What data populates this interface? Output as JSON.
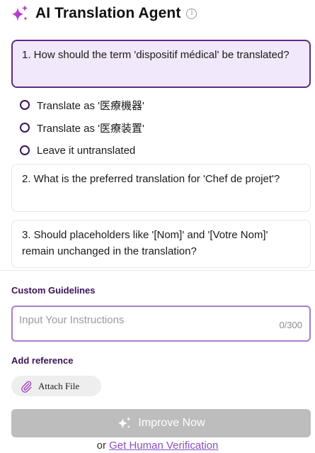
{
  "header": {
    "title": "AI Translation Agent",
    "info_glyph": "i",
    "sparkle_icon": "sparkles-icon",
    "brand_gradient": [
      "#e03cbd",
      "#8b3ad9"
    ]
  },
  "questions": [
    {
      "text": "1. How should the term 'dispositif médical' be translated?",
      "active": true
    },
    {
      "text": "2. What is the preferred translation for 'Chef de projet'?",
      "active": false
    },
    {
      "text": "3. Should placeholders like '[Nom]' and '[Votre Nom]' remain unchanged in the translation?",
      "active": false
    }
  ],
  "options": [
    {
      "label": "Translate as '医療機器'",
      "selected": false
    },
    {
      "label": "Translate as '医療装置'",
      "selected": false
    },
    {
      "label": "Leave it untranslated",
      "selected": false
    }
  ],
  "guidelines": {
    "label": "Custom Guidelines",
    "placeholder": "Input Your Instructions",
    "value": "",
    "counter": "0/300"
  },
  "reference": {
    "label": "Add reference",
    "attach_label": "Attach File",
    "attach_icon": "paperclip-icon"
  },
  "actions": {
    "improve_label": "Improve Now",
    "improve_icon": "sparkles-icon",
    "or_text": "or",
    "verification_link": "Get Human Verification"
  },
  "colors": {
    "accent": "#5b2a86",
    "active_card_bg": "#f1e8fb",
    "input_border": "#a77cc9",
    "disabled_button": "#bdbdbd",
    "link": "#8a4fc4"
  }
}
